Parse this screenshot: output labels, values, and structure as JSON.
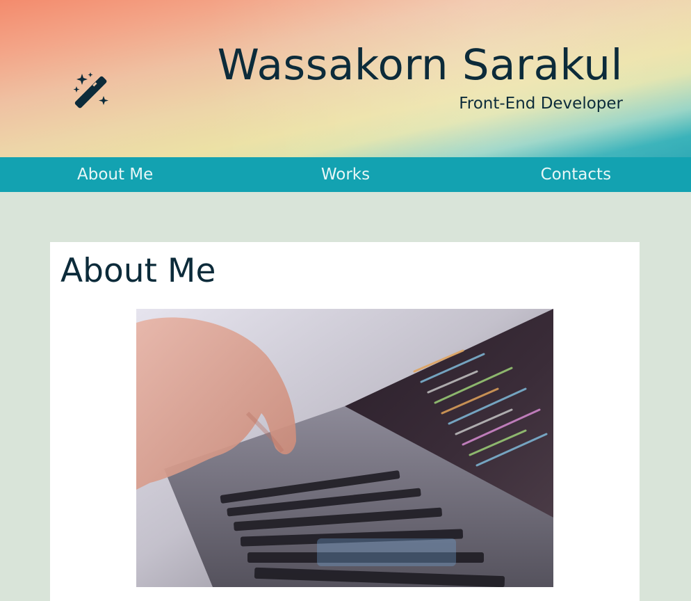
{
  "header": {
    "name": "Wassakorn Sarakul",
    "subtitle": "Front-End Developer",
    "logo_icon": "magic-wand-icon"
  },
  "nav": {
    "items": [
      {
        "label": "About Me"
      },
      {
        "label": "Works"
      },
      {
        "label": "Contacts"
      }
    ]
  },
  "about": {
    "title": "About Me",
    "photo_subject": "hand typing on laptop keyboard with code on screen"
  },
  "colors": {
    "background": "#d9e4d9",
    "nav": "#13a2b1",
    "text_dark": "#0c2b3a",
    "nav_text": "#e8f7f7"
  }
}
